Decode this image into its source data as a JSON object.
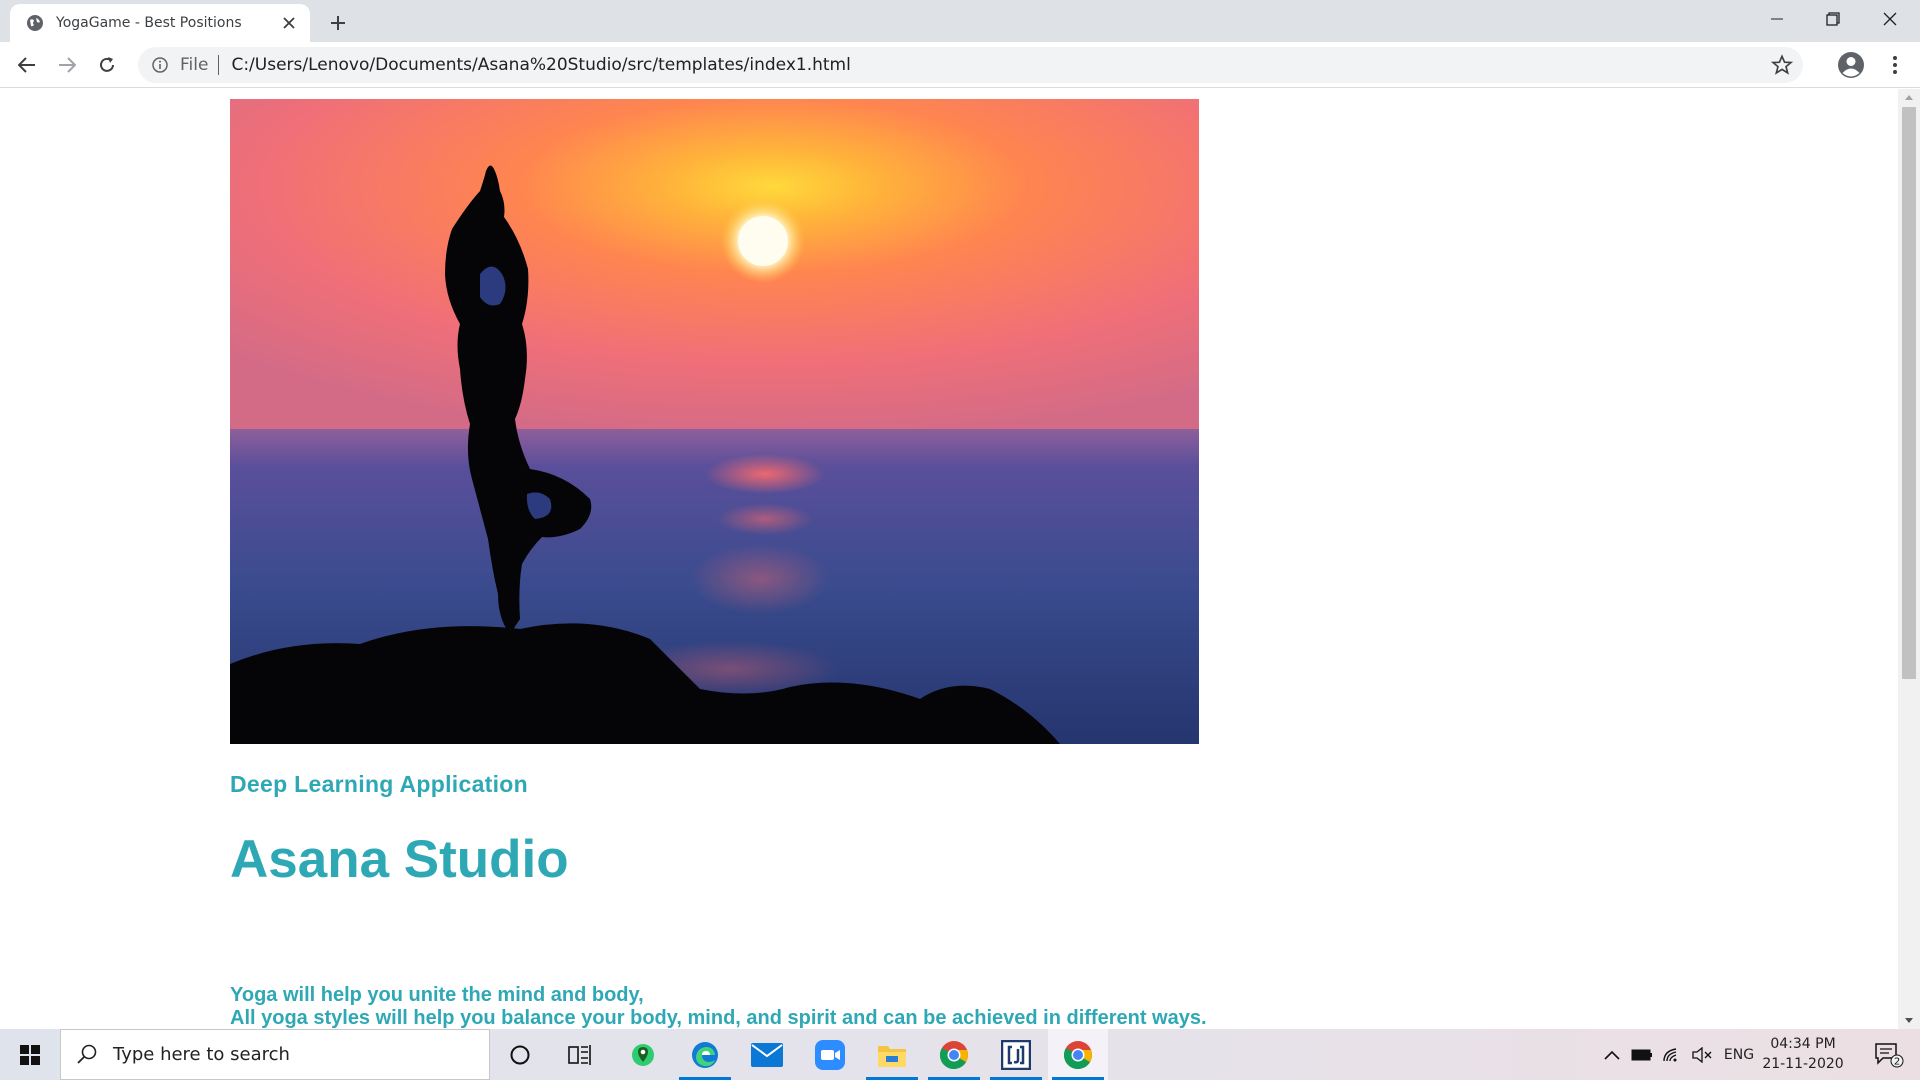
{
  "browser": {
    "tab_title": "YogaGame - Best Positions",
    "omnibox_scheme": "File",
    "url": "C:/Users/Lenovo/Documents/Asana%20Studio/src/templates/index1.html"
  },
  "page": {
    "hero_image_description_icon": "yoga-sunset-photo",
    "kicker": "Deep Learning Application",
    "title": "Asana Studio",
    "line1": "Yoga will help you unite the mind and body,",
    "line2": "All yoga styles will help you balance your body, mind, and spirit and can be achieved in different ways.",
    "accent_color": "#2fa8b5"
  },
  "taskbar": {
    "search_placeholder": "Type here to search",
    "language": "ENG",
    "time": "04:34 PM",
    "date": "21-11-2020",
    "notification_count": "2",
    "pinned_icons": [
      "cortana-icon",
      "task-view-icon",
      "maps-icon",
      "edge-icon",
      "mail-icon",
      "zoom-icon",
      "file-explorer-icon",
      "chrome-icon",
      "bracket-app-icon",
      "chrome-icon"
    ]
  }
}
